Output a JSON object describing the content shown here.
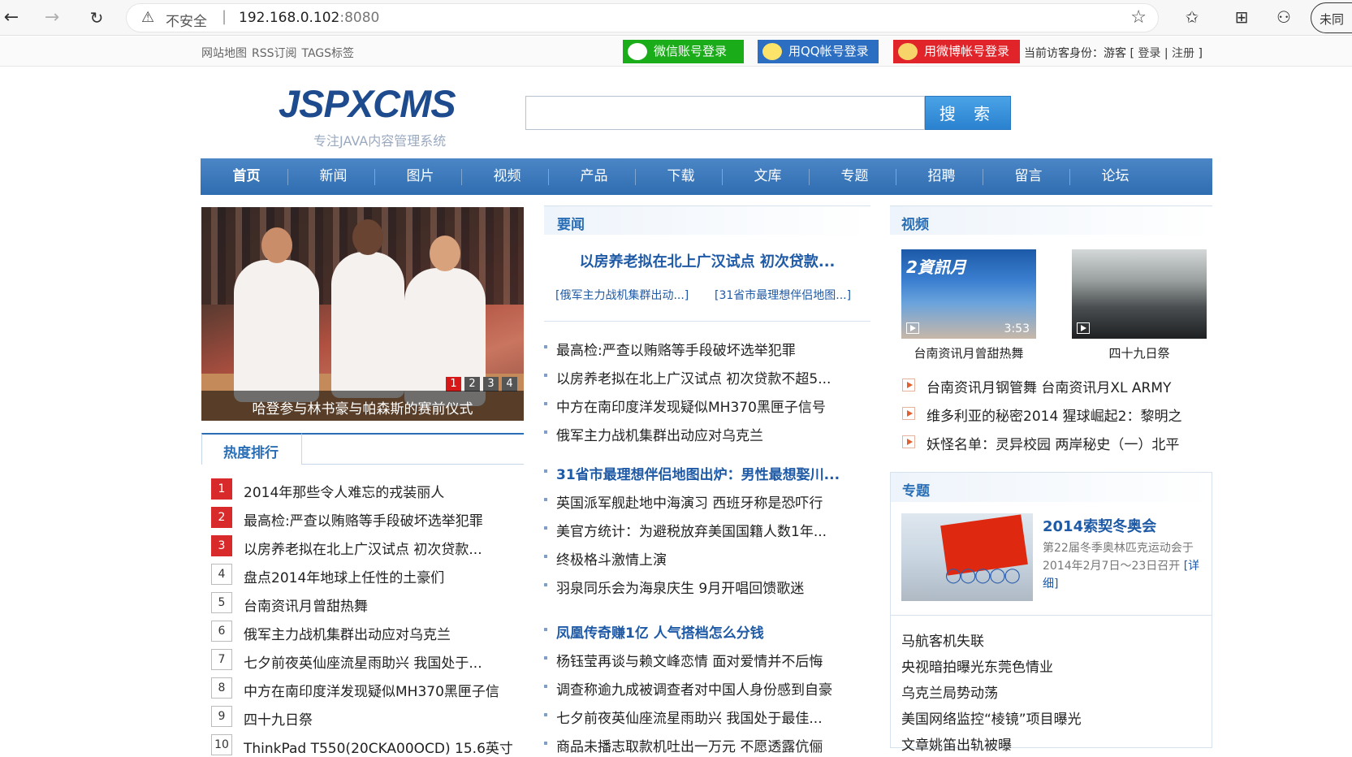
{
  "browser": {
    "security_label": "不安全",
    "url_host": "192.168.0.102",
    "url_port": ":8080",
    "profile_label": "未同"
  },
  "utility": {
    "links": [
      "网站地图",
      "RSS订阅",
      "TAGS标签"
    ],
    "wechat_login": "微信账号登录",
    "qq_login": "用QQ帐号登录",
    "weibo_login": "用微博帐号登录",
    "visitor_prefix": "当前访客身份：游客 [",
    "login": "登录",
    "divider": "|",
    "register": "注册",
    "visitor_suffix": "]"
  },
  "header": {
    "logo": "JSPXCMS",
    "slogan": "专注JAVA内容管理系统",
    "search_button": "搜 索",
    "search_value": ""
  },
  "nav": {
    "items": [
      "首页",
      "新闻",
      "图片",
      "视频",
      "产品",
      "下载",
      "文库",
      "专题",
      "招聘",
      "留言",
      "论坛"
    ]
  },
  "slideshow": {
    "caption": "哈登参与林书豪与帕森斯的赛前仪式",
    "pages": [
      "1",
      "2",
      "3",
      "4"
    ],
    "active_page": 1
  },
  "hot": {
    "tab": "热度排行",
    "items": [
      {
        "rank": "1",
        "title": "2014年那些令人难忘的戎装丽人"
      },
      {
        "rank": "2",
        "title": "最高检:严查以贿赂等手段破坏选举犯罪"
      },
      {
        "rank": "3",
        "title": "以房养老拟在北上广汉试点 初次贷款..."
      },
      {
        "rank": "4",
        "title": "盘点2014年地球上任性的土豪们"
      },
      {
        "rank": "5",
        "title": "台南资讯月曾甜热舞"
      },
      {
        "rank": "6",
        "title": "俄军主力战机集群出动应对乌克兰"
      },
      {
        "rank": "7",
        "title": "七夕前夜英仙座流星雨助兴 我国处于..."
      },
      {
        "rank": "8",
        "title": "中方在南印度洋发现疑似MH370黑匣子信"
      },
      {
        "rank": "9",
        "title": "四十九日祭"
      },
      {
        "rank": "10",
        "title": "ThinkPad T550(20CKA00OCD) 15.6英寸"
      }
    ]
  },
  "news": {
    "heading": "要闻",
    "feature": "以房养老拟在北上广汉试点 初次贷款...",
    "sub_left": "[俄军主力战机集群出动...]",
    "sub_right": "[31省市最理想伴侣地图...]",
    "items": [
      {
        "title": "最高检:严查以贿赂等手段破坏选举犯罪",
        "head": false
      },
      {
        "title": "以房养老拟在北上广汉试点 初次贷款不超5...",
        "head": false
      },
      {
        "title": "中方在南印度洋发现疑似MH370黑匣子信号",
        "head": false
      },
      {
        "title": "俄军主力战机集群出动应对乌克兰",
        "head": false
      },
      {
        "title": "31省市最理想伴侣地图出炉：男性最想娶川...",
        "head": true
      },
      {
        "title": "英国派军舰赴地中海演习 西班牙称是恐吓行",
        "head": false
      },
      {
        "title": "美官方统计：为避税放弃美国国籍人数1年...",
        "head": false
      },
      {
        "title": "终极格斗激情上演",
        "head": false
      },
      {
        "title": "羽泉同乐会为海泉庆生 9月开唱回馈歌迷",
        "head": false
      },
      {
        "title": "凤凰传奇赚1亿 人气搭档怎么分钱",
        "head": true
      },
      {
        "title": "杨钰莹再谈与赖文峰恋情 面对爱情并不后悔",
        "head": false
      },
      {
        "title": "调查称逾九成被调查者对中国人身份感到自豪",
        "head": false
      },
      {
        "title": "七夕前夜英仙座流星雨助兴 我国处于最佳...",
        "head": false
      },
      {
        "title": "商品未播志取款机吐出一万元 不愿透露伉俪",
        "head": false
      }
    ]
  },
  "video": {
    "heading": "视频",
    "thumbs": [
      {
        "caption": "台南资讯月曾甜热舞",
        "duration": "3:53"
      },
      {
        "caption": "四十九日祭",
        "duration": ""
      }
    ],
    "rows": [
      "台南资讯月钢管舞  台南资讯月XL ARMY",
      "维多利亚的秘密2014  猩球崛起2：黎明之",
      "妖怪名单：灵异校园  两岸秘史（一）北平"
    ]
  },
  "topic": {
    "heading": "专题",
    "title": "2014索契冬奥会",
    "desc": "第22届冬季奥林匹克运动会于2014年2月7日～23日召开",
    "detail": "[详细]",
    "items": [
      "马航客机失联",
      "央视暗拍曝光东莞色情业",
      "乌克兰局势动荡",
      "美国网络监控“棱镜”项目曝光",
      "文章姚笛出轨被曝"
    ]
  },
  "colors": {
    "brand_blue": "#2a6fb6",
    "nav_blue": "#3b78bd",
    "rank_red": "#d82a2a",
    "wechat_green": "#1aad19",
    "qq_blue": "#2b6ec2",
    "weibo_red": "#e0242a"
  },
  "icons": [
    "back-arrow-icon",
    "forward-arrow-icon",
    "reload-icon",
    "warning-icon",
    "star-icon",
    "favorites-icon",
    "collections-icon",
    "feedback-icon",
    "wechat-icon",
    "qq-icon",
    "weibo-icon",
    "play-icon"
  ]
}
